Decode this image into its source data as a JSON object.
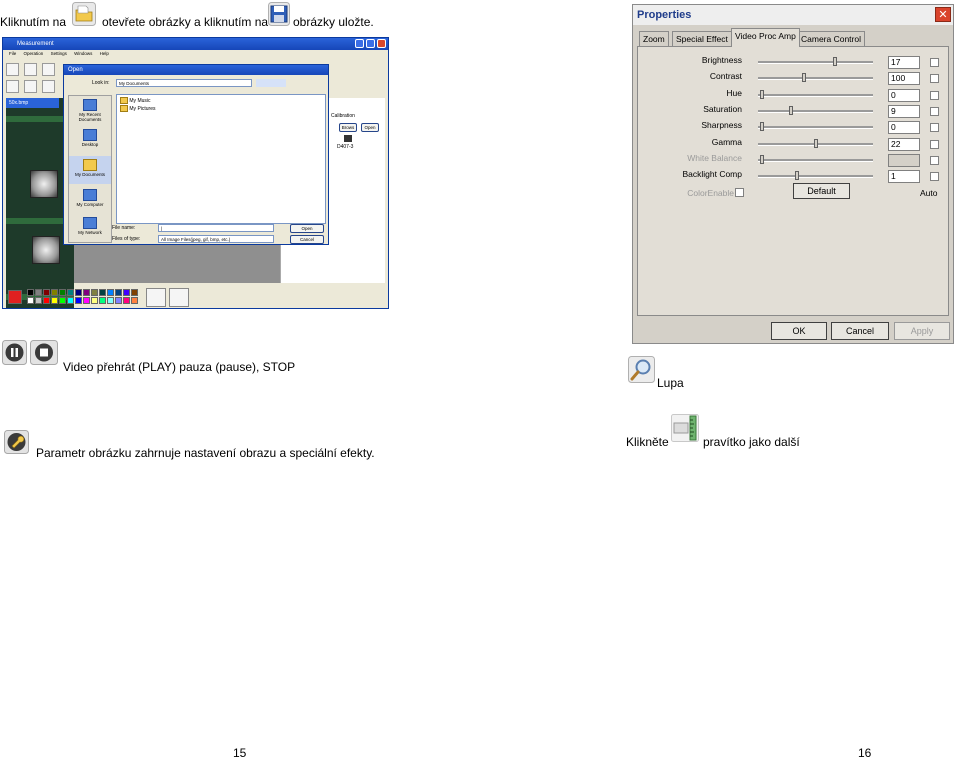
{
  "top_caption": {
    "part1": "Kliknutím na",
    "part2": "otevřete obrázky a kliknutím na",
    "part3": "obrázky uložte.",
    "open_icon": "open-folder-icon",
    "save_icon": "floppy-save-icon"
  },
  "measurement_app": {
    "title": "Measurement",
    "menu": [
      "File",
      "Operation",
      "Settings",
      "Windows",
      "Help"
    ],
    "file_tab": "50x.bmp",
    "calibration_label": "Calibration",
    "calibration_buttons": [
      "Brows",
      "Open"
    ],
    "calibration_file": "D407-3",
    "open_dialog": {
      "title": "Open",
      "look_in_label": "Look in:",
      "look_in_value": "My Documents",
      "folders": [
        "My Music",
        "My Pictures"
      ],
      "places": [
        "My Recent Documents",
        "Desktop",
        "My Documents",
        "My Computer",
        "My Network"
      ],
      "file_name_label": "File name:",
      "file_name_value": "|",
      "files_of_type_label": "Files of type:",
      "files_of_type_value": "All Image Files(jpeg, gif, bmp, etc.)",
      "open_button": "Open",
      "cancel_button": "Cancel"
    }
  },
  "properties_dialog": {
    "title": "Properties",
    "close_glyph": "✕",
    "tabs": [
      "Zoom",
      "Special Effect",
      "Video Proc Amp",
      "Camera Control"
    ],
    "active_tab": "Video Proc Amp",
    "rows": [
      {
        "label": "Brightness",
        "value": "17",
        "slider_position": 0.68,
        "enabled": true
      },
      {
        "label": "Contrast",
        "value": "100",
        "slider_position": 0.4,
        "enabled": true
      },
      {
        "label": "Hue",
        "value": "0",
        "slider_position": 0.02,
        "enabled": true
      },
      {
        "label": "Saturation",
        "value": "9",
        "slider_position": 0.28,
        "enabled": true
      },
      {
        "label": "Sharpness",
        "value": "0",
        "slider_position": 0.02,
        "enabled": true
      },
      {
        "label": "Gamma",
        "value": "22",
        "slider_position": 0.5,
        "enabled": true
      },
      {
        "label": "White Balance",
        "value": "",
        "slider_position": 0.02,
        "enabled": false
      },
      {
        "label": "Backlight Comp",
        "value": "1",
        "slider_position": 0.33,
        "enabled": true
      }
    ],
    "color_enable_label": "ColorEnable",
    "default_button": "Default",
    "auto_label": "Auto",
    "ok_button": "OK",
    "cancel_button": "Cancel",
    "apply_button": "Apply"
  },
  "video_section": {
    "text": "Video přehrát (PLAY) pauza (pause), STOP",
    "icons": [
      "pause-icon",
      "stop-icon"
    ]
  },
  "zoom_section": {
    "text": "Lupa",
    "icon": "magnifier-icon"
  },
  "image_param_section": {
    "text": "Parametr obrázku zahrnuje nastavení obrazu a speciální efekty.",
    "icon": "wrench-settings-icon"
  },
  "ruler_section": {
    "text_before": "Klikněte",
    "text_after": "pravítko jako další",
    "icon": "ruler-icon"
  },
  "page_numbers": {
    "left": "15",
    "right": "16"
  }
}
